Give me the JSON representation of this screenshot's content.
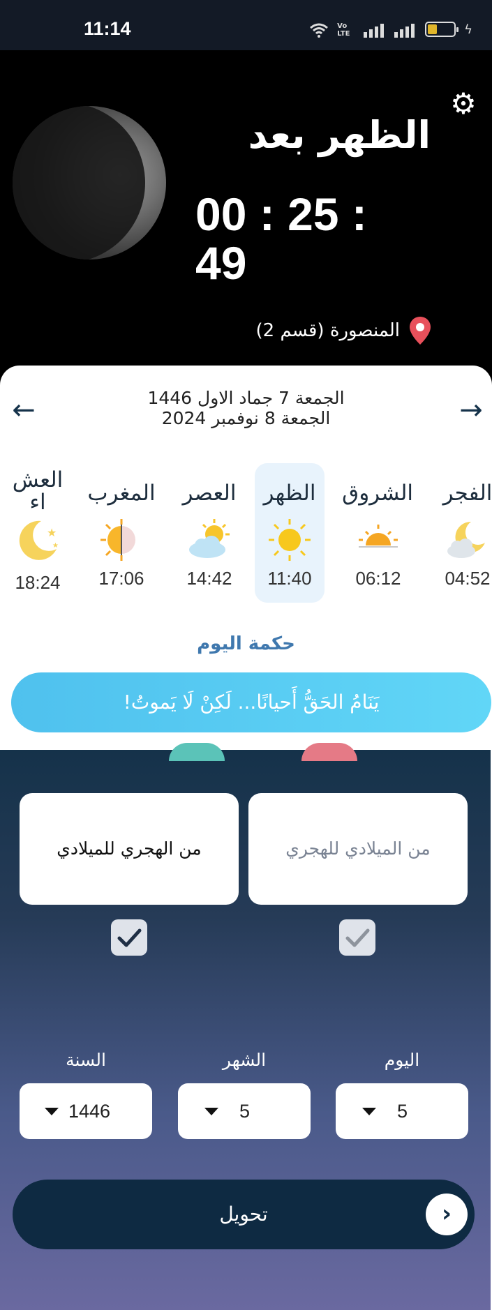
{
  "status_bar": {
    "time": "11:14",
    "volte_label": "Vo LTE"
  },
  "hero": {
    "prayer_label": "الظهر بعد",
    "countdown": "00 : 25 : 49",
    "location": "المنصورة (قسم 2)"
  },
  "date_nav": {
    "hijri_date": "الجمعة 7 جماد الاول 1446",
    "gregorian_date": "الجمعة 8 نوفمبر 2024"
  },
  "prayers": [
    {
      "name": "الفجر",
      "time": "04:52",
      "icon": "moon-cloud-icon"
    },
    {
      "name": "الشروق",
      "time": "06:12",
      "icon": "sunrise-icon"
    },
    {
      "name": "الظهر",
      "time": "11:40",
      "icon": "sun-icon",
      "active": true
    },
    {
      "name": "العصر",
      "time": "14:42",
      "icon": "sun-cloud-icon"
    },
    {
      "name": "المغرب",
      "time": "17:06",
      "icon": "half-sun-icon"
    },
    {
      "name": "العشاء",
      "name_line1": "العش",
      "name_line2": "اء",
      "time": "18:24",
      "icon": "crescent-icon"
    }
  ],
  "wisdom": {
    "title": "حكمة اليوم",
    "text": "يَنَامُ الحَقُّ أَحيانًا... لَكِنْ لَا يَموتُ!"
  },
  "converter": {
    "mode_hijri_to_greg": "من الهجري للميلادي",
    "mode_greg_to_hijri": "من الميلادي للهجري",
    "year_label": "السنة",
    "month_label": "الشهر",
    "day_label": "اليوم",
    "year_value": "1446",
    "month_value": "5",
    "day_value": "5",
    "convert_label": "تحويل"
  },
  "colors": {
    "accent": "#3f78ae",
    "panel_top": "#15324a",
    "panel_bottom": "#6a69a0",
    "wisdom_bg": "#55c8f2",
    "active_prayer_bg": "#e8f3fc",
    "pin_red": "#e8505b"
  }
}
